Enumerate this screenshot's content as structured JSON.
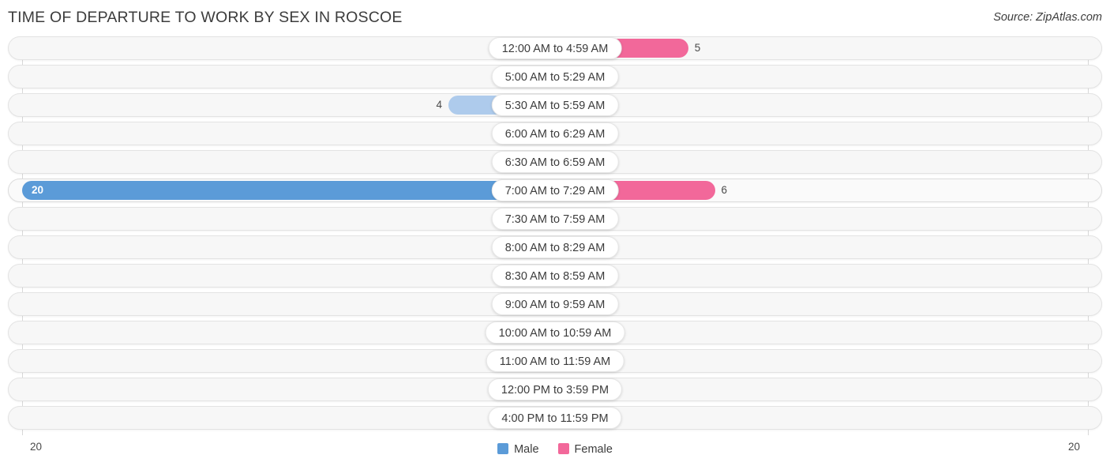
{
  "header": {
    "title": "TIME OF DEPARTURE TO WORK BY SEX IN ROSCOE",
    "source": "Source: ZipAtlas.com"
  },
  "axis": {
    "left_label": "20",
    "right_label": "20"
  },
  "legend": {
    "items": [
      {
        "label": "Male",
        "color": "#5b9bd8",
        "swatch": "male"
      },
      {
        "label": "Female",
        "color": "#f2689a",
        "swatch": "female"
      }
    ]
  },
  "colors": {
    "male_strong": "#5b9bd8",
    "male_light": "#aecbec",
    "female_strong": "#f2689a",
    "female_light": "#f8aec8",
    "track": "#f7f7f7",
    "track_border": "#e3e3e3",
    "gridline": "#d8d8d8",
    "text": "#3c3c3c"
  },
  "chart_data": {
    "type": "bar",
    "title": "TIME OF DEPARTURE TO WORK BY SEX IN ROSCOE",
    "subtitle": "",
    "orientation": "horizontal-diverging",
    "xlabel": "",
    "ylabel": "",
    "axis_max": 20,
    "xlim": [
      20,
      20
    ],
    "grid": true,
    "legend_position": "bottom-center",
    "categories": [
      "12:00 AM to 4:59 AM",
      "5:00 AM to 5:29 AM",
      "5:30 AM to 5:59 AM",
      "6:00 AM to 6:29 AM",
      "6:30 AM to 6:59 AM",
      "7:00 AM to 7:29 AM",
      "7:30 AM to 7:59 AM",
      "8:00 AM to 8:29 AM",
      "8:30 AM to 8:59 AM",
      "9:00 AM to 9:59 AM",
      "10:00 AM to 10:59 AM",
      "11:00 AM to 11:59 AM",
      "12:00 PM to 3:59 PM",
      "4:00 PM to 11:59 PM"
    ],
    "series": [
      {
        "name": "Male",
        "color": "#5b9bd8",
        "values": [
          0,
          0,
          4,
          0,
          0,
          20,
          0,
          0,
          0,
          0,
          0,
          0,
          0,
          0
        ]
      },
      {
        "name": "Female",
        "color": "#f2689a",
        "values": [
          5,
          0,
          0,
          0,
          0,
          6,
          0,
          0,
          0,
          0,
          0,
          0,
          0,
          0
        ]
      }
    ]
  },
  "rows": [
    {
      "label": "12:00 AM to 4:59 AM",
      "male": 0,
      "female": 5,
      "male_text": "0",
      "female_text": "5",
      "highlight": false
    },
    {
      "label": "5:00 AM to 5:29 AM",
      "male": 0,
      "female": 0,
      "male_text": "0",
      "female_text": "0",
      "highlight": false
    },
    {
      "label": "5:30 AM to 5:59 AM",
      "male": 4,
      "female": 0,
      "male_text": "4",
      "female_text": "0",
      "highlight": false
    },
    {
      "label": "6:00 AM to 6:29 AM",
      "male": 0,
      "female": 0,
      "male_text": "0",
      "female_text": "0",
      "highlight": false
    },
    {
      "label": "6:30 AM to 6:59 AM",
      "male": 0,
      "female": 0,
      "male_text": "0",
      "female_text": "0",
      "highlight": false
    },
    {
      "label": "7:00 AM to 7:29 AM",
      "male": 20,
      "female": 6,
      "male_text": "20",
      "female_text": "6",
      "highlight": true
    },
    {
      "label": "7:30 AM to 7:59 AM",
      "male": 0,
      "female": 0,
      "male_text": "0",
      "female_text": "0",
      "highlight": false
    },
    {
      "label": "8:00 AM to 8:29 AM",
      "male": 0,
      "female": 0,
      "male_text": "0",
      "female_text": "0",
      "highlight": false
    },
    {
      "label": "8:30 AM to 8:59 AM",
      "male": 0,
      "female": 0,
      "male_text": "0",
      "female_text": "0",
      "highlight": false
    },
    {
      "label": "9:00 AM to 9:59 AM",
      "male": 0,
      "female": 0,
      "male_text": "0",
      "female_text": "0",
      "highlight": false
    },
    {
      "label": "10:00 AM to 10:59 AM",
      "male": 0,
      "female": 0,
      "male_text": "0",
      "female_text": "0",
      "highlight": false
    },
    {
      "label": "11:00 AM to 11:59 AM",
      "male": 0,
      "female": 0,
      "male_text": "0",
      "female_text": "0",
      "highlight": false
    },
    {
      "label": "12:00 PM to 3:59 PM",
      "male": 0,
      "female": 0,
      "male_text": "0",
      "female_text": "0",
      "highlight": false
    },
    {
      "label": "4:00 PM to 11:59 PM",
      "male": 0,
      "female": 0,
      "male_text": "0",
      "female_text": "0",
      "highlight": false
    }
  ]
}
